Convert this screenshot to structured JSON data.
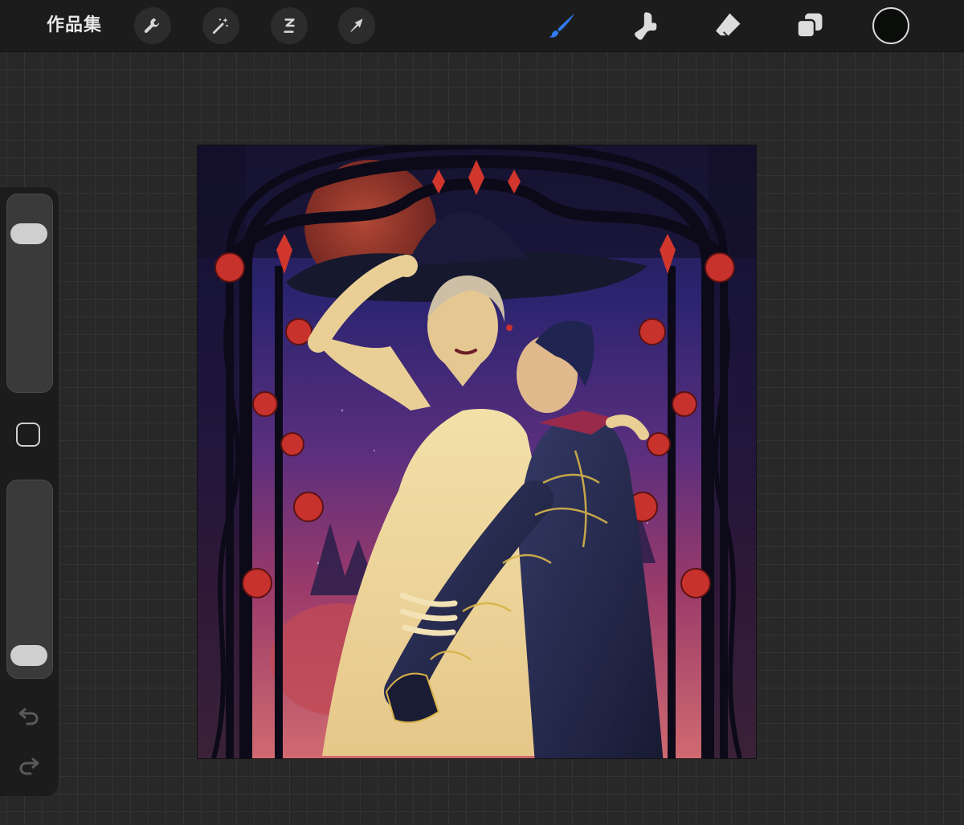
{
  "toolbar": {
    "gallery_label": "作品集",
    "left_tools": [
      "wrench-icon",
      "magic-wand-icon",
      "selection-icon",
      "transform-arrow-icon"
    ],
    "right_tools": [
      "brush-icon",
      "smudge-icon",
      "eraser-icon",
      "layers-icon"
    ],
    "active_tool": "brush-icon",
    "accent_color": "#2f7bf0",
    "current_color": "#0b0d0b"
  },
  "sidebar": {
    "brush_size_level": 0.85,
    "opacity_level": 0.05
  }
}
